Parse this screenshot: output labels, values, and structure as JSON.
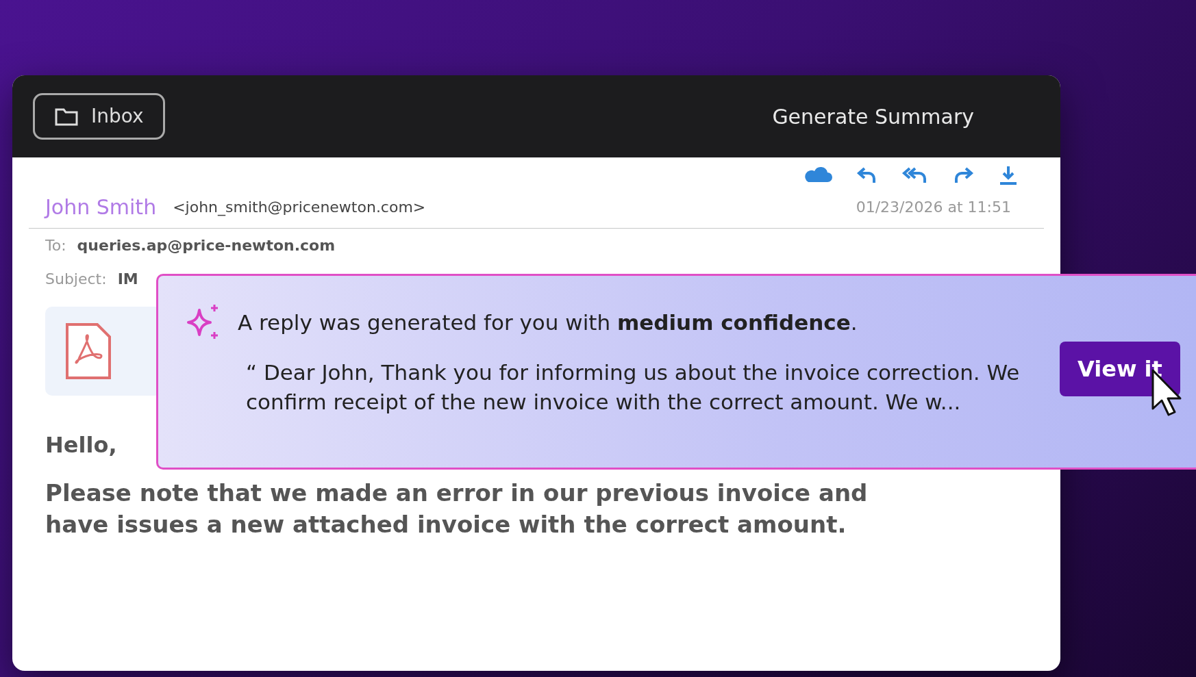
{
  "header": {
    "inbox_button": "Inbox",
    "action": "Generate Summary"
  },
  "email": {
    "sender_name": "John Smith",
    "sender_address": "<john_smith@pricenewton.com>",
    "date": "01/23/2026 at 11:51",
    "to_label": "To:",
    "to": "queries.ap@price-newton.com",
    "subject_label": "Subject:",
    "subject": "IM",
    "greeting": "Hello,",
    "body": "Please note that we made an error in our previous invoice and have issues a new attached invoice with the correct amount."
  },
  "notification": {
    "message": "A reply was generated for you with **medium confidence**.",
    "quote": "“ Dear John, Thank you for informing us about the invoice correction. We confirm receipt of the new invoice with the correct amount. We w...",
    "button": "View it"
  }
}
